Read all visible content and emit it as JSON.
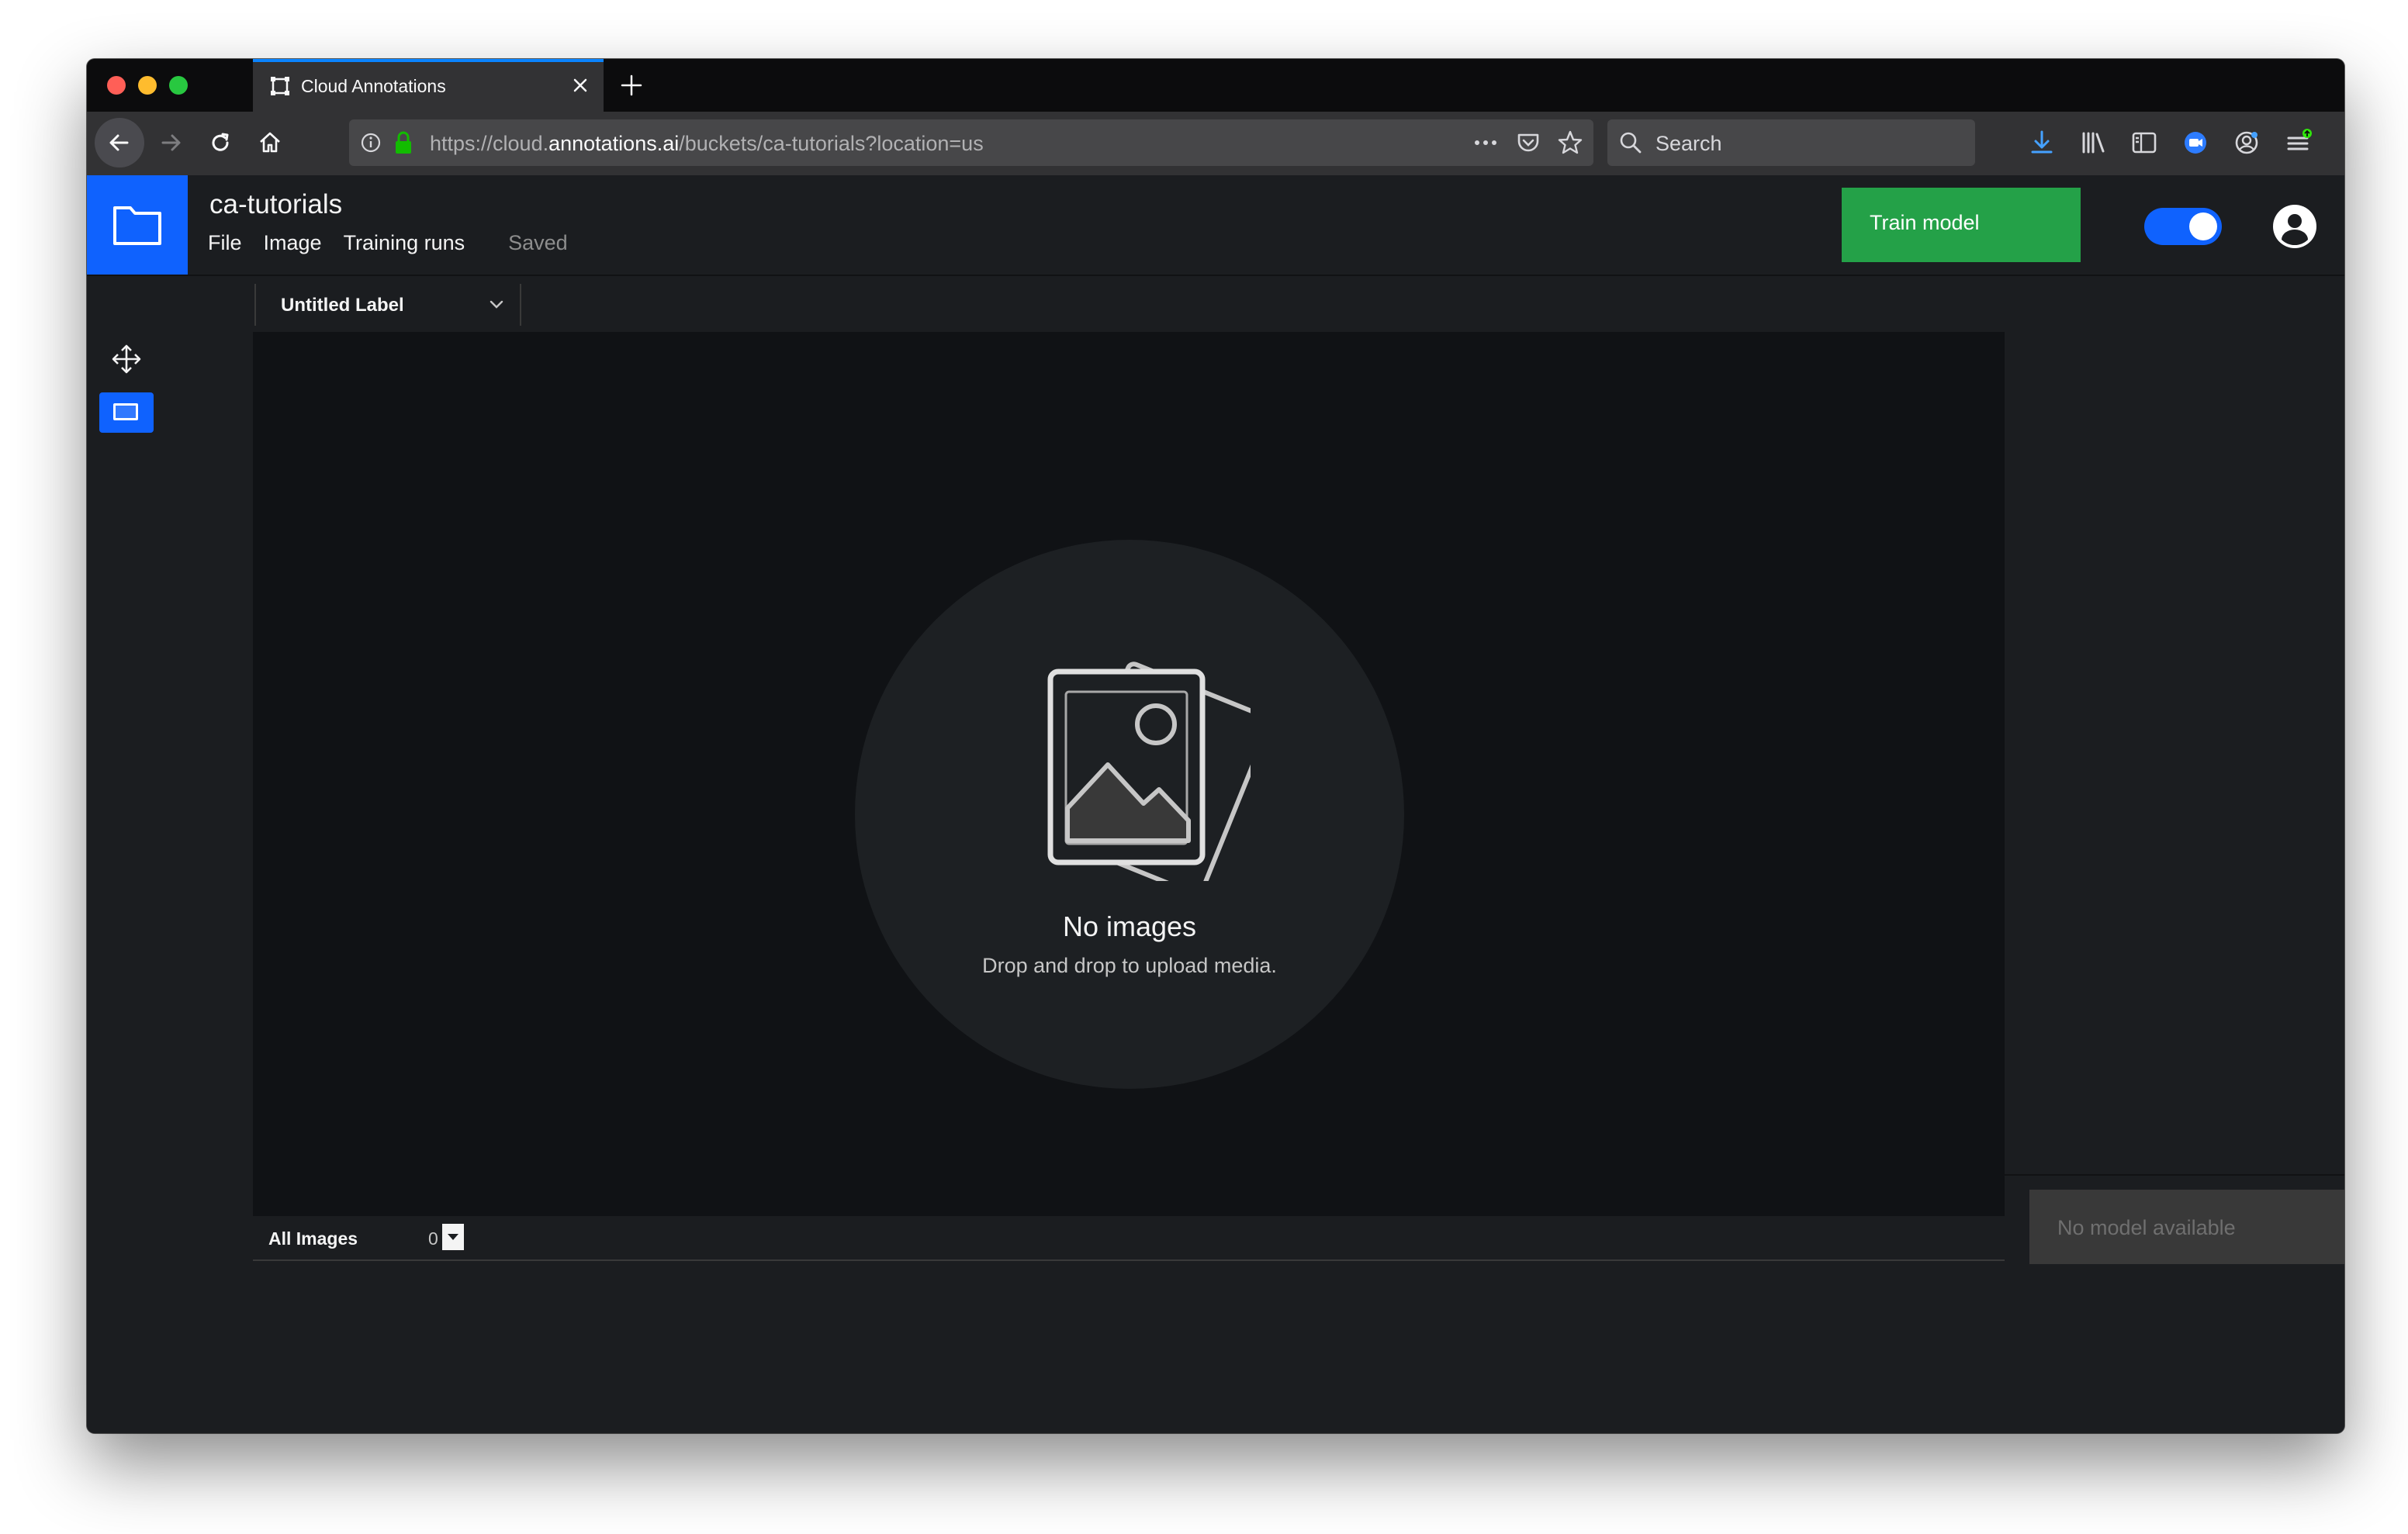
{
  "browser": {
    "tab_title": "Cloud Annotations",
    "url_prefix": "https://cloud.",
    "url_host": "annotations.ai",
    "url_path": "/buckets/ca-tutorials?location=us",
    "search_placeholder": "Search"
  },
  "header": {
    "bucket_name": "ca-tutorials",
    "menu": [
      "File",
      "Image",
      "Training runs"
    ],
    "save_status": "Saved",
    "train_button": "Train model",
    "toggle_on": true
  },
  "label_bar": {
    "selected_label": "Untitled Label"
  },
  "empty_state": {
    "title": "No images",
    "subtitle": "Drop and drop to upload media."
  },
  "images_bar": {
    "filter_label": "All Images",
    "count": "0"
  },
  "right_panel": {
    "model_status": "No model available"
  },
  "colors": {
    "accent": "#0f62fe",
    "train": "#24a148",
    "background": "#1b1d20",
    "canvas": "#101215"
  }
}
